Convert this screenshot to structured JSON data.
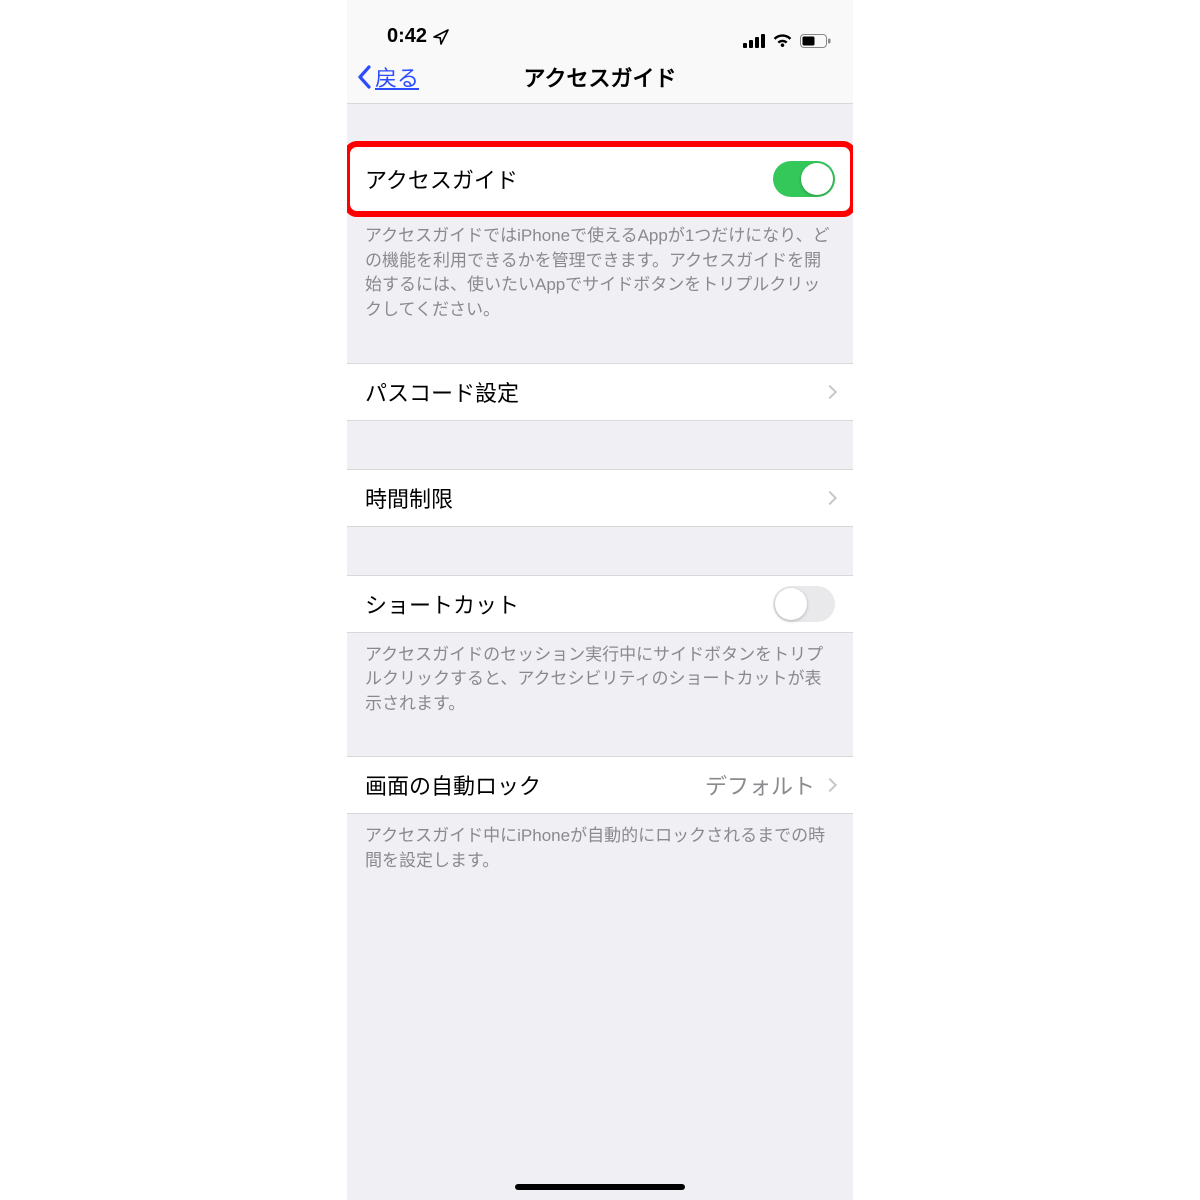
{
  "statusbar": {
    "time": "0:42",
    "location_icon": "location-arrow-icon",
    "signal_icon": "cellular-signal-icon",
    "wifi_icon": "wifi-icon",
    "battery_icon": "battery-icon"
  },
  "nav": {
    "back_label": "戻る",
    "title": "アクセスガイド"
  },
  "cells": {
    "access_guide": {
      "label": "アクセスガイド",
      "toggle_on": true
    },
    "access_guide_note": "アクセスガイドではiPhoneで使えるAppが1つだけになり、どの機能を利用できるかを管理できます。アクセスガイドを開始するには、使いたいAppでサイドボタンをトリプルクリックしてください。",
    "passcode": {
      "label": "パスコード設定"
    },
    "time_limit": {
      "label": "時間制限"
    },
    "shortcut": {
      "label": "ショートカット",
      "toggle_on": false
    },
    "shortcut_note": "アクセスガイドのセッション実行中にサイドボタンをトリプルクリックすると、アクセシビリティのショートカットが表示されます。",
    "auto_lock": {
      "label": "画面の自動ロック",
      "value": "デフォルト"
    },
    "auto_lock_note": "アクセスガイド中にiPhoneが自動的にロックされるまでの時間を設定します。"
  }
}
